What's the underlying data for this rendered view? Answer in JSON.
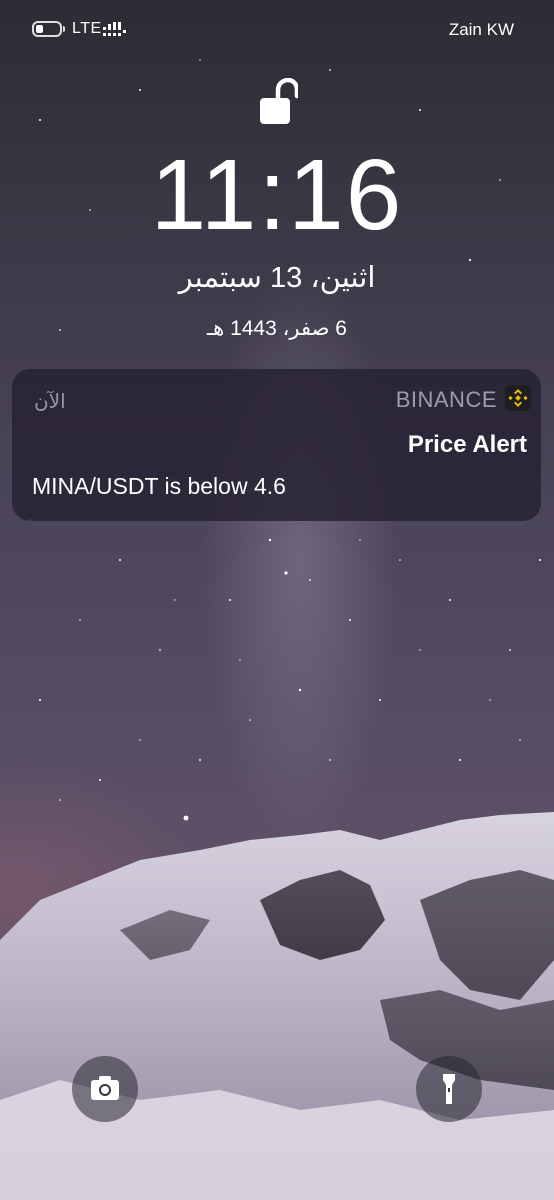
{
  "status_bar": {
    "network": "LTE",
    "carrier": "Zain KW"
  },
  "lock_screen": {
    "time": "11:16",
    "date": "اثنين، 13 سبتمبر",
    "hijri_date": "6 صفر، 1443 هـ"
  },
  "notification": {
    "app_name": "BINANCE",
    "time": "الآن",
    "title": "Price Alert",
    "body": "MINA/USDT is below 4.6",
    "app_icon": "binance-logo-icon",
    "accent_color": "#F0B90B"
  },
  "quick_actions": {
    "camera_icon": "camera-icon",
    "flashlight_icon": "flashlight-icon"
  }
}
